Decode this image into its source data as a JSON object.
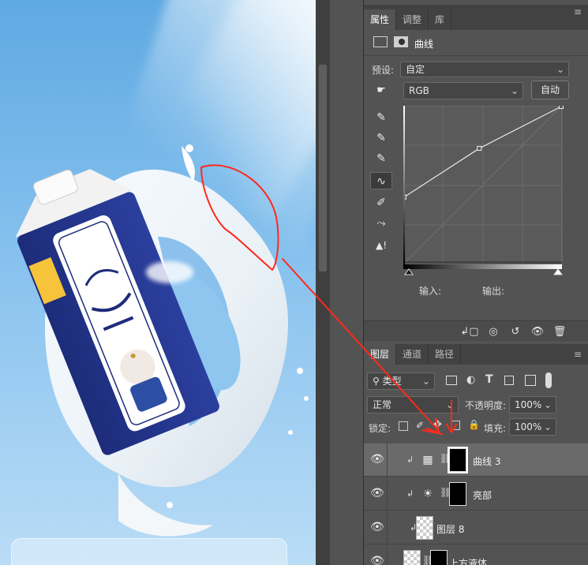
{
  "properties_panel": {
    "tabs": [
      {
        "label": "属性",
        "active": true
      },
      {
        "label": "调整",
        "active": false
      },
      {
        "label": "库",
        "active": false
      }
    ],
    "adjustment_title": "曲线",
    "preset_label": "预设:",
    "preset_value": "自定",
    "channel_value": "RGB",
    "auto_button": "自动",
    "input_label": "输入:",
    "output_label": "输出:",
    "tools": [
      "sample-in-image-icon",
      "black-point-eyedropper-icon",
      "gray-point-eyedropper-icon",
      "white-point-eyedropper-icon",
      "curve-points-icon",
      "pencil-icon",
      "smooth-icon",
      "clipping-warning-icon"
    ],
    "footer_icons": [
      "clip-to-layer-icon",
      "view-previous-icon",
      "reset-icon",
      "visibility-icon",
      "trash-icon"
    ]
  },
  "curve": {
    "points": [
      [
        0,
        0
      ],
      [
        0,
        108
      ],
      [
        122,
        187
      ],
      [
        255,
        255
      ]
    ],
    "range": [
      0,
      255
    ]
  },
  "layers_panel": {
    "tabs": [
      {
        "label": "图层",
        "active": true
      },
      {
        "label": "通道",
        "active": false
      },
      {
        "label": "路径",
        "active": false
      }
    ],
    "filter_label": "类型",
    "blend_mode": "正常",
    "opacity_label": "不透明度:",
    "opacity_value": "100%",
    "lock_label": "锁定:",
    "fill_label": "填充:",
    "fill_value": "100%",
    "layers": [
      {
        "name": "曲线 3",
        "type": "curves",
        "selected": true
      },
      {
        "name": "亮部",
        "type": "brightness",
        "selected": false
      },
      {
        "name": "图层 8",
        "type": "pixel",
        "selected": false
      },
      {
        "name": "上方液体",
        "type": "pixel-masked",
        "selected": false
      }
    ]
  },
  "annotation_color": "#ff2a1a"
}
